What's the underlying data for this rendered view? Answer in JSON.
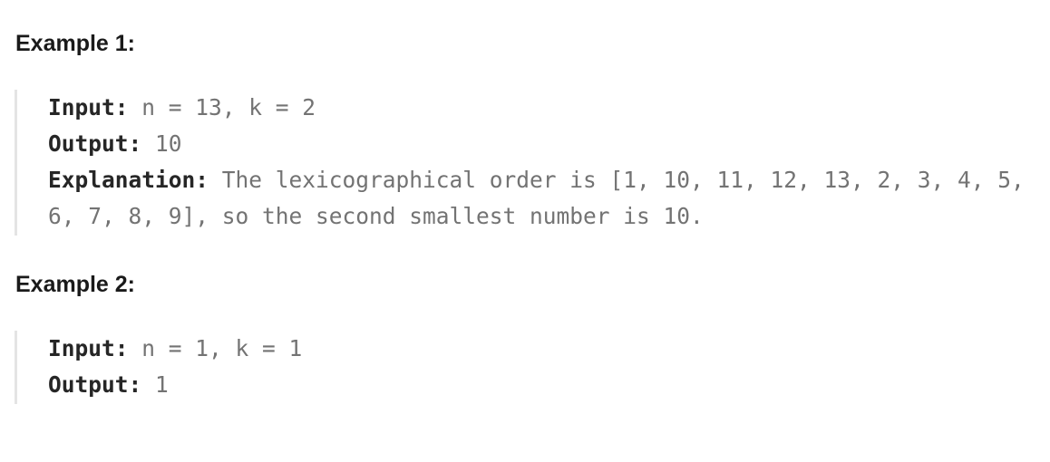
{
  "examples": [
    {
      "heading": "Example 1:",
      "input_label": "Input:",
      "input_value": "n = 13, k = 2",
      "output_label": "Output:",
      "output_value": "10",
      "explanation_label": "Explanation:",
      "explanation_value": "The lexicographical order is [1, 10, 11, 12, 13, 2, 3, 4, 5, 6, 7, 8, 9], so the second smallest number is 10."
    },
    {
      "heading": "Example 2:",
      "input_label": "Input:",
      "input_value": "n = 1, k = 1",
      "output_label": "Output:",
      "output_value": "1"
    }
  ]
}
